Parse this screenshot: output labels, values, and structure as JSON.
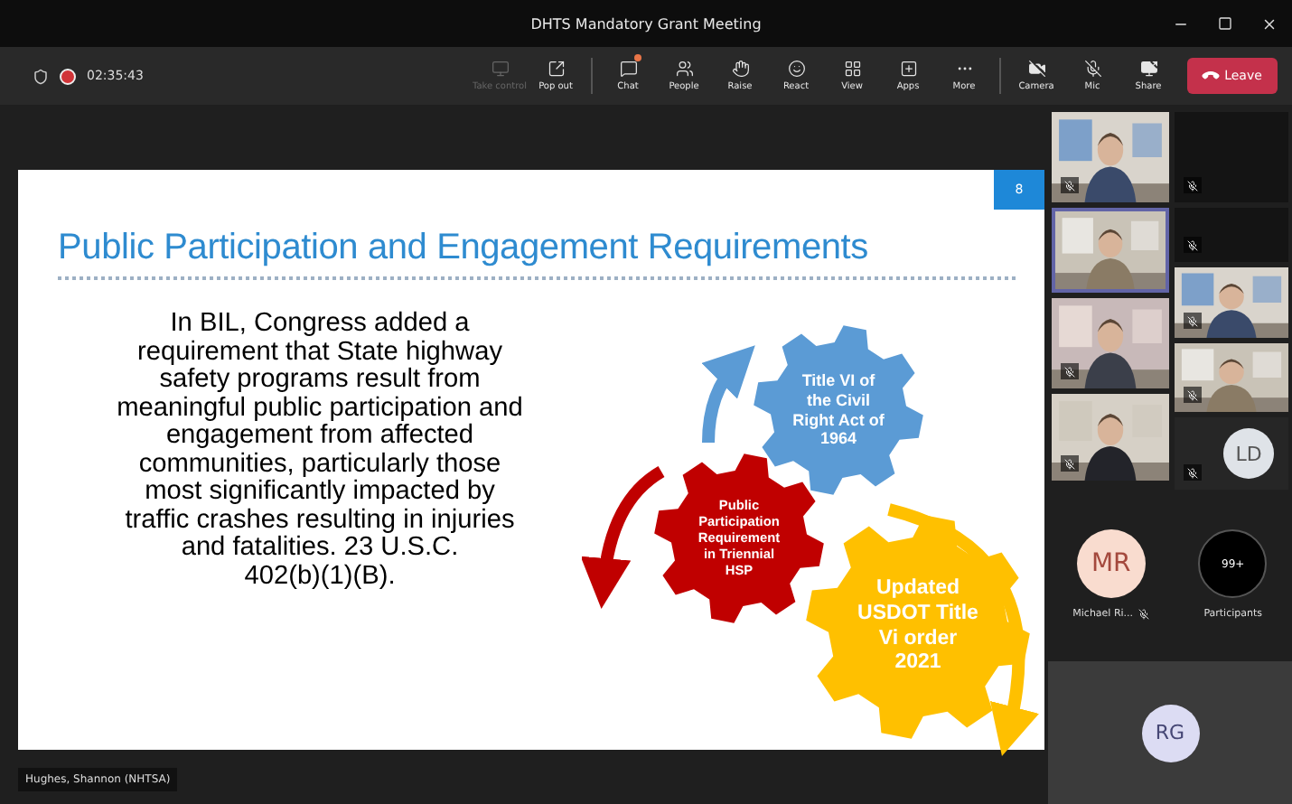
{
  "window": {
    "title": "DHTS Mandatory Grant Meeting"
  },
  "call": {
    "recording": true,
    "timer": "02:35:43"
  },
  "toolbar": [
    {
      "kind": "take-control",
      "label": "Take control",
      "disabled": true
    },
    {
      "kind": "pop-out",
      "label": "Pop out",
      "disabled": false
    },
    {
      "kind": "chat",
      "label": "Chat",
      "disabled": false,
      "badge": true
    },
    {
      "kind": "people",
      "label": "People",
      "disabled": false
    },
    {
      "kind": "raise",
      "label": "Raise",
      "disabled": false
    },
    {
      "kind": "react",
      "label": "React",
      "disabled": false
    },
    {
      "kind": "view",
      "label": "View",
      "disabled": false
    },
    {
      "kind": "apps",
      "label": "Apps",
      "disabled": false
    },
    {
      "kind": "more",
      "label": "More",
      "disabled": false
    },
    {
      "kind": "camera",
      "label": "Camera",
      "disabled": false,
      "off": true
    },
    {
      "kind": "mic",
      "label": "Mic",
      "disabled": false,
      "off": true
    },
    {
      "kind": "share",
      "label": "Share",
      "disabled": false
    }
  ],
  "leave_button": {
    "label": "Leave"
  },
  "slide": {
    "number": "8",
    "title": "Public Participation and Engagement Requirements",
    "body": "In BIL, Congress added a\nrequirement that State highway\nsafety programs result from\nmeaningful public participation and\nengagement from affected\ncommunities, particularly those\nmost significantly impacted by\ntraffic crashes resulting in injuries\nand fatalities.  23 U.S.C.\n402(b)(1)(B).",
    "gears": [
      {
        "label": "Title VI of\nthe Civil\nRight Act of\n1964",
        "color": "#5b9bd5"
      },
      {
        "label": "Public\nParticipation\nRequirement\nin Triennial\nHSP",
        "color": "#c00000"
      },
      {
        "label": "Updated\nUSDOT Title\nVi order\n2021",
        "color": "#ffc000"
      }
    ]
  },
  "presenter": {
    "name": "Hughes, Shannon (NHTSA)"
  },
  "tiles": {
    "column_1": [
      {
        "kind": "video",
        "muted": true,
        "selected": false
      },
      {
        "kind": "video",
        "muted": false,
        "selected": true
      },
      {
        "kind": "video",
        "muted": true,
        "selected": false
      },
      {
        "kind": "video",
        "muted": true,
        "selected": false
      }
    ],
    "column_2": [
      {
        "kind": "blank",
        "muted": true,
        "selected": false
      },
      {
        "kind": "blank",
        "muted": true,
        "selected": false
      },
      {
        "kind": "video",
        "muted": true,
        "selected": false
      },
      {
        "kind": "video",
        "muted": true,
        "selected": false
      },
      {
        "kind": "avatar",
        "initials": "LD",
        "color": "#dfe3e8",
        "muted": true,
        "selected": false
      }
    ]
  },
  "overflow": [
    {
      "kind": "person",
      "initials": "MR",
      "color": "#f9dccf",
      "name": "Michael Ri...",
      "muted": true
    },
    {
      "kind": "count",
      "initials": "99+",
      "color": "#000000",
      "name": "Participants"
    }
  ],
  "spotlight": {
    "initials": "RG",
    "color": "#dcdcf3"
  }
}
